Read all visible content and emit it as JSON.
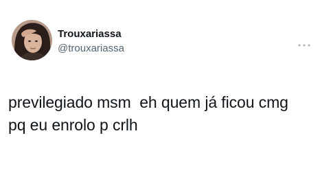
{
  "author": {
    "display_name": "Trouxariassa",
    "handle": "@trouxariassa",
    "avatar_icon": "profile-photo"
  },
  "tweet": {
    "text": "previlegiado msm  eh quem já ficou cmg\npq eu enrolo p crlh"
  },
  "menu": {
    "icon": "more-horizontal-icon"
  },
  "colors": {
    "text": "#0f1419",
    "secondary": "#536471",
    "background": "#ffffff"
  }
}
